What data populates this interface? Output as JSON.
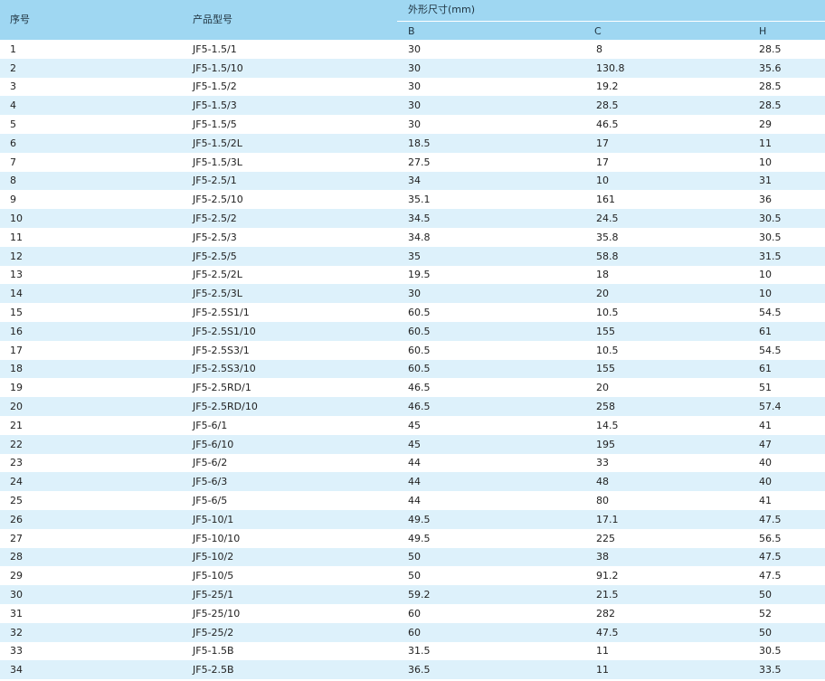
{
  "table": {
    "headers": {
      "index": "序号",
      "model": "产品型号",
      "dimensions_group": "外形尺寸(mm)",
      "b": "B",
      "c": "C",
      "h": "H"
    },
    "rows": [
      {
        "idx": "1",
        "model": "JF5-1.5/1",
        "b": "30",
        "c": "8",
        "h": "28.5"
      },
      {
        "idx": "2",
        "model": "JF5-1.5/10",
        "b": "30",
        "c": "130.8",
        "h": "35.6"
      },
      {
        "idx": "3",
        "model": "JF5-1.5/2",
        "b": "30",
        "c": "19.2",
        "h": "28.5"
      },
      {
        "idx": "4",
        "model": "JF5-1.5/3",
        "b": "30",
        "c": "28.5",
        "h": "28.5"
      },
      {
        "idx": "5",
        "model": "JF5-1.5/5",
        "b": "30",
        "c": "46.5",
        "h": "29"
      },
      {
        "idx": "6",
        "model": "JF5-1.5/2L",
        "b": "18.5",
        "c": "17",
        "h": "11"
      },
      {
        "idx": "7",
        "model": "JF5-1.5/3L",
        "b": "27.5",
        "c": "17",
        "h": "10"
      },
      {
        "idx": "8",
        "model": "JF5-2.5/1",
        "b": "34",
        "c": "10",
        "h": "31"
      },
      {
        "idx": "9",
        "model": "JF5-2.5/10",
        "b": "35.1",
        "c": "161",
        "h": "36"
      },
      {
        "idx": "10",
        "model": "JF5-2.5/2",
        "b": "34.5",
        "c": "24.5",
        "h": "30.5"
      },
      {
        "idx": "11",
        "model": "JF5-2.5/3",
        "b": "34.8",
        "c": "35.8",
        "h": "30.5"
      },
      {
        "idx": "12",
        "model": "JF5-2.5/5",
        "b": "35",
        "c": "58.8",
        "h": "31.5"
      },
      {
        "idx": "13",
        "model": "JF5-2.5/2L",
        "b": "19.5",
        "c": "18",
        "h": "10"
      },
      {
        "idx": "14",
        "model": "JF5-2.5/3L",
        "b": "30",
        "c": "20",
        "h": "10"
      },
      {
        "idx": "15",
        "model": "JF5-2.5S1/1",
        "b": "60.5",
        "c": "10.5",
        "h": "54.5"
      },
      {
        "idx": "16",
        "model": "JF5-2.5S1/10",
        "b": "60.5",
        "c": "155",
        "h": "61"
      },
      {
        "idx": "17",
        "model": "JF5-2.5S3/1",
        "b": "60.5",
        "c": "10.5",
        "h": "54.5"
      },
      {
        "idx": "18",
        "model": "JF5-2.5S3/10",
        "b": "60.5",
        "c": "155",
        "h": "61"
      },
      {
        "idx": "19",
        "model": "JF5-2.5RD/1",
        "b": "46.5",
        "c": "20",
        "h": "51"
      },
      {
        "idx": "20",
        "model": "JF5-2.5RD/10",
        "b": "46.5",
        "c": "258",
        "h": "57.4"
      },
      {
        "idx": "21",
        "model": "JF5-6/1",
        "b": "45",
        "c": "14.5",
        "h": "41"
      },
      {
        "idx": "22",
        "model": "JF5-6/10",
        "b": "45",
        "c": "195",
        "h": "47"
      },
      {
        "idx": "23",
        "model": "JF5-6/2",
        "b": "44",
        "c": "33",
        "h": "40"
      },
      {
        "idx": "24",
        "model": "JF5-6/3",
        "b": "44",
        "c": "48",
        "h": "40"
      },
      {
        "idx": "25",
        "model": "JF5-6/5",
        "b": "44",
        "c": "80",
        "h": "41"
      },
      {
        "idx": "26",
        "model": "JF5-10/1",
        "b": "49.5",
        "c": "17.1",
        "h": "47.5"
      },
      {
        "idx": "27",
        "model": "JF5-10/10",
        "b": "49.5",
        "c": "225",
        "h": "56.5"
      },
      {
        "idx": "28",
        "model": "JF5-10/2",
        "b": "50",
        "c": "38",
        "h": "47.5"
      },
      {
        "idx": "29",
        "model": "JF5-10/5",
        "b": "50",
        "c": "91.2",
        "h": "47.5"
      },
      {
        "idx": "30",
        "model": "JF5-25/1",
        "b": "59.2",
        "c": "21.5",
        "h": "50"
      },
      {
        "idx": "31",
        "model": "JF5-25/10",
        "b": "60",
        "c": "282",
        "h": "52"
      },
      {
        "idx": "32",
        "model": "JF5-25/2",
        "b": "60",
        "c": "47.5",
        "h": "50"
      },
      {
        "idx": "33",
        "model": "JF5-1.5B",
        "b": "31.5",
        "c": "11",
        "h": "30.5"
      },
      {
        "idx": "34",
        "model": "JF5-2.5B",
        "b": "36.5",
        "c": "11",
        "h": "33.5"
      }
    ]
  },
  "colors": {
    "header_bg": "#9fd7f2",
    "alt_row_bg": "#ddf1fb",
    "row_bg": "#ffffff"
  }
}
